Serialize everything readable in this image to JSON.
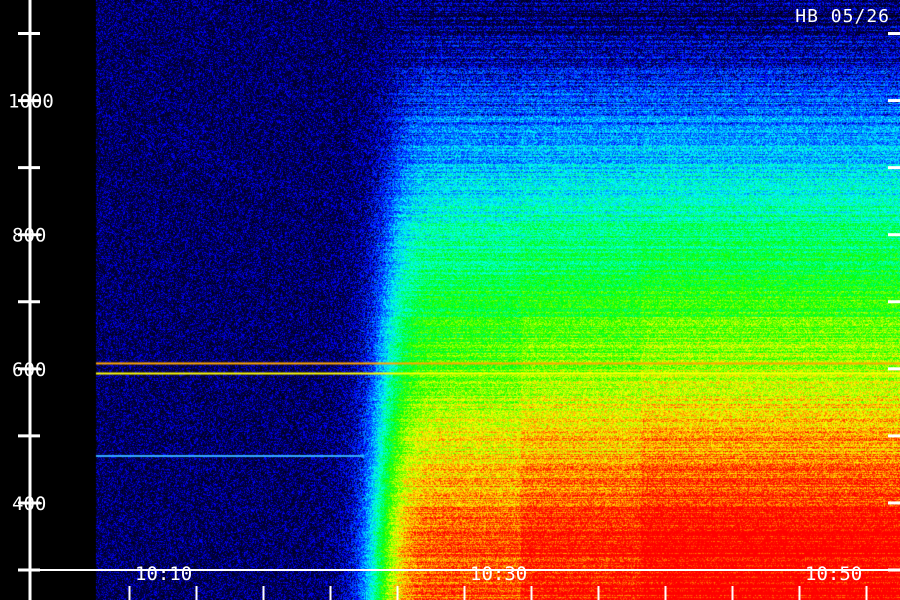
{
  "station_label": "HB 05/26",
  "chart_data": {
    "type": "heatmap",
    "title": "",
    "xlabel": "",
    "ylabel": "",
    "x_tick_labels": [
      "10:10",
      "10:30",
      "10:50"
    ],
    "x_ticks": [
      "10:10",
      "10:30",
      "10:50"
    ],
    "y_tick_labels": [
      "400",
      "600",
      "800",
      "1000"
    ],
    "y_labeled_ticks": [
      400,
      600,
      800,
      1000
    ],
    "y_minor_ticks": [
      300,
      500,
      700,
      900,
      1100
    ],
    "ylim": [
      300,
      1150
    ],
    "xlim": [
      "10:06",
      "10:54"
    ],
    "colormap": [
      "#000000",
      "#0000ff",
      "#00ffff",
      "#00ff00",
      "#ffff00",
      "#ff0000"
    ],
    "onset_time": "10:24",
    "interference_lines": [
      {
        "freq": 608,
        "start": "10:06",
        "color": "#ffaa00"
      },
      {
        "freq": 593,
        "start": "10:06",
        "color": "#ffff00"
      },
      {
        "freq": 470,
        "start": "10:06",
        "end": "10:22",
        "color": "#33aaff"
      }
    ],
    "notes": "Solar radio spectrogram; emission intensity increases at lower frequencies after onset."
  }
}
